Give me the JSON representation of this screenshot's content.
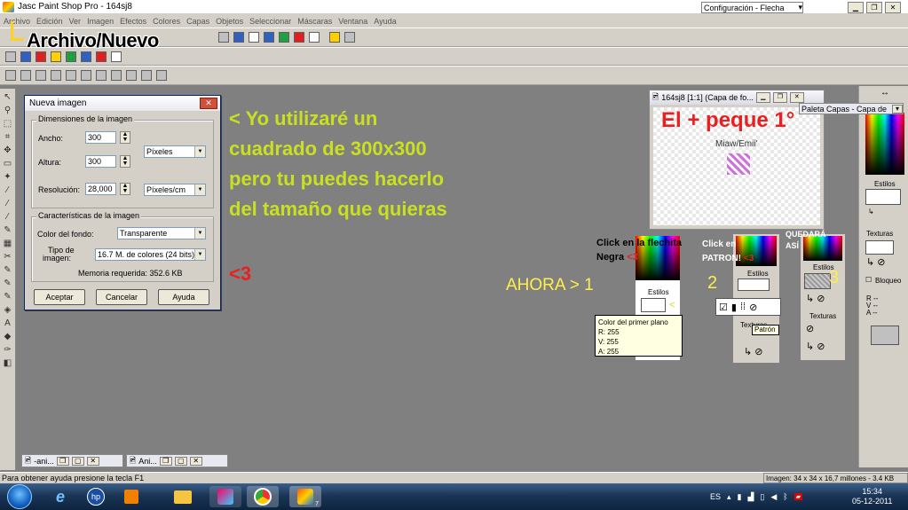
{
  "window": {
    "title": "Jasc Paint Shop Pro - 164sj8",
    "config_select": "Configuración - Flecha"
  },
  "menu": [
    "Archivo",
    "Edición",
    "Ver",
    "Imagen",
    "Efectos",
    "Colores",
    "Capas",
    "Objetos",
    "Seleccionar",
    "Máscaras",
    "Ventana",
    "Ayuda"
  ],
  "overlay": {
    "archivo_nuevo": "Archivo/Nuevo",
    "yellow_lines": [
      "< Yo utilizaré un",
      "cuadrado de 300x300",
      "pero tu puedes hacerlo",
      "del tamaño que quieras"
    ],
    "heart": "<3",
    "canvas_red": "El + peque 1°",
    "canvas_signature": "Miaw/Emii'",
    "ahora": "AHORA > 1",
    "step2": "2",
    "step3": "3",
    "hint1_a": "Click en la flechita",
    "hint1_b": "Negra",
    "hint1_c": "<3",
    "hint2_a": "Click en",
    "hint2_b": "PATRON!",
    "hint2_c": "<3",
    "hint3_a": "QUEDARÁ",
    "hint3_b": "ASÍ"
  },
  "dialog": {
    "title": "Nueva imagen",
    "dims_group": "Dimensiones de la imagen",
    "width_label": "Ancho:",
    "width_value": "300",
    "height_label": "Altura:",
    "height_value": "300",
    "units": "Píxeles",
    "resolution_label": "Resolución:",
    "resolution_value": "28,000",
    "res_units": "Píxeles/cm",
    "char_group": "Características de la imagen",
    "bg_label": "Color del fondo:",
    "bg_value": "Transparente",
    "type_label_1": "Tipo de",
    "type_label_2": "imagen:",
    "type_value": "16.7 M. de colores (24 bits)",
    "memory": "Memoria requerida: 352.6 KB",
    "ok": "Aceptar",
    "cancel": "Cancelar",
    "help": "Ayuda"
  },
  "image_window": {
    "title": "164sj8 [1:1] (Capa de fo..."
  },
  "palette": {
    "title": "Paleta Capas - Capa de",
    "estilos": "Estilos",
    "texturas": "Texturas",
    "bloqueo": "Bloqueo",
    "rva": [
      "R",
      "V",
      "A"
    ],
    "rva_values": [
      "--",
      "--",
      "--"
    ]
  },
  "tooltip": {
    "title": "Color del primer plano",
    "r": "R: 255",
    "v": "V: 255",
    "a": "A: 255"
  },
  "patron_tooltip": "Patrón",
  "minimized": [
    {
      "label": "-ani..."
    },
    {
      "label": "Ani..."
    }
  ],
  "status": {
    "left": "Para obtener ayuda presione la tecla F1",
    "right": "Imagen:  34 x 34 x 16,7 millones - 3.4 KB"
  },
  "taskbar": {
    "lang": "ES",
    "time": "15:34",
    "date": "05-12-2011",
    "badge": "7"
  }
}
